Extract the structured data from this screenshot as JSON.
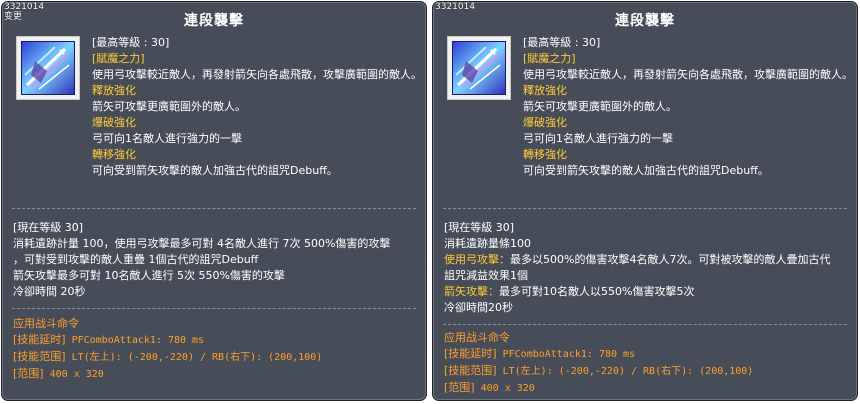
{
  "colors": {
    "panel_bg": "#464d58",
    "highlight": "#ffcc33",
    "combat": "#ff9f2a",
    "text": "#ffffff"
  },
  "left": {
    "id_tag": "3321014",
    "sub_tag": "变更",
    "title": "連段襲擊",
    "icon": "skill-arrow-icon",
    "desc": {
      "max_level": "[最高等級 : 30]",
      "subtitle": "[賦魔之力]",
      "main": "使用弓攻擊較近敵人，再發射箭矢向各處飛散，攻擊廣範圍的敵人。",
      "enh1_name": "釋放強化",
      "enh1_text": "箭矢可攻擊更廣範圍外的敵人。",
      "enh2_name": "爆破強化",
      "enh2_text": "弓可向1名敵人進行強力的一擊",
      "enh3_name": "轉移強化",
      "enh3_text": "可向受到箭矢攻擊的敵人加強古代的詛咒Debuff。"
    },
    "stats": {
      "level": "[現在等級 30]",
      "line1": "消耗遺跡計量 100，使用弓攻擊最多可對 4名敵人進行 7次 500%傷害的攻",
      "line1b": "擊",
      "line2": "，可對受到攻擊的敵人重疊 1個古代的詛咒Debuff",
      "line3": "箭矢攻擊最多可對 10名敵人進行 5次 550%傷害的攻擊",
      "line4": "冷卻時間 20秒"
    },
    "combat": {
      "header": "应用战斗命令",
      "delay_label": "[技能延时]",
      "delay_value": " PFComboAttack1: 780 ms",
      "range_label": "[技能范围]",
      "range_value": " LT(左上): (-200,-220) / RB(右下): (200,100)",
      "area_label": "[范围]",
      "area_value": " 400 x 320"
    }
  },
  "right": {
    "id_tag": "3321014",
    "title": "連段襲擊",
    "icon": "skill-arrow-icon",
    "desc": {
      "max_level": "[最高等級 : 30]",
      "subtitle": "[賦魔之力]",
      "main": "使用弓攻擊較近敵人，再發射箭矢向各處飛散，攻擊廣範圍的敵人。",
      "enh1_name": "釋放強化",
      "enh1_text": "箭矢可攻擊更廣範圍外的敵人。",
      "enh2_name": "爆破強化",
      "enh2_text": "弓可向1名敵人進行強力的一擊",
      "enh3_name": "轉移強化",
      "enh3_text": "可向受到箭矢攻擊的敵人加強古代的詛咒Debuff。"
    },
    "stats": {
      "level": "[現在等級 30]",
      "line1": "消耗遺跡量條100",
      "line2_label": "使用弓攻擊：",
      "line2_text": "最多以500%的傷害攻擊4名敵人7次。可對被攻擊的敵人疊加古代",
      "line2b": "詛咒減益效果1個",
      "line3_label": "箭矢攻擊：",
      "line3_text": "最多可對10名敵人以550%傷害攻擊5次",
      "line4": "冷卻時間20秒"
    },
    "combat": {
      "header": "应用战斗命令",
      "delay_label": "[技能延时]",
      "delay_value": " PFComboAttack1: 780 ms",
      "range_label": "[技能范围]",
      "range_value": " LT(左上): (-200,-220) / RB(右下): (200,100)",
      "area_label": "[范围]",
      "area_value": " 400 x 320"
    }
  }
}
